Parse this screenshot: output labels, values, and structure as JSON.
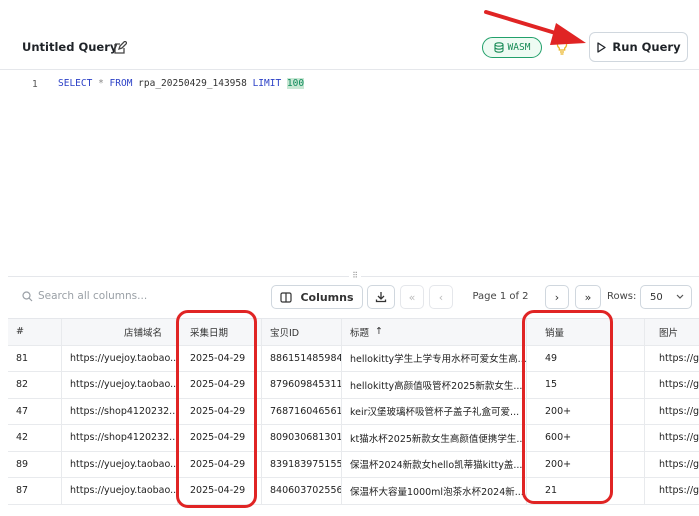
{
  "header": {
    "title": "Untitled Query",
    "engine_badge": "WASM",
    "run_label": "Run Query"
  },
  "editor": {
    "line_number": "1",
    "tokens": {
      "select": "SELECT",
      "star": "*",
      "from": "FROM",
      "table": "rpa_20250429_143958",
      "limit": "LIMIT",
      "limit_value": "100"
    }
  },
  "toolbar": {
    "search_placeholder": "Search all columns...",
    "columns_label": "Columns",
    "page_text": "Page 1 of 2",
    "rows_label": "Rows:",
    "rows_value": "50"
  },
  "table": {
    "columns": [
      "#",
      "店铺域名",
      "采集日期",
      "宝贝ID",
      "标题",
      "销量",
      "图片"
    ],
    "sort_indicator": "↑",
    "rows": [
      [
        "81",
        "https://yuejoy.taobao....",
        "2025-04-29",
        "886151485984",
        "hellokitty学生上学专用水杯可爱女生高...",
        "49",
        "https://g"
      ],
      [
        "82",
        "https://yuejoy.taobao....",
        "2025-04-29",
        "879609845311",
        "hellokitty高颜值吸管杯2025新款女生...",
        "15",
        "https://g"
      ],
      [
        "47",
        "https://shop4120232...",
        "2025-04-29",
        "768716046561",
        "keir汉堡玻璃杯吸管杯子盖子礼盒可爱...",
        "200+",
        "https://g"
      ],
      [
        "42",
        "https://shop4120232...",
        "2025-04-29",
        "809030681301",
        "kt猫水杯2025新款女生高颜值便携学生...",
        "600+",
        "https://g"
      ],
      [
        "89",
        "https://yuejoy.taobao....",
        "2025-04-29",
        "839183975155",
        "保温杯2024新款女hello凯蒂猫kitty盖...",
        "200+",
        "https://g"
      ],
      [
        "87",
        "https://yuejoy.taobao....",
        "2025-04-29",
        "840603702556",
        "保温杯大容量1000ml泡茶水杯2024新...",
        "21",
        "https://g"
      ]
    ]
  },
  "colors": {
    "annotation": "#e02424",
    "wasm_green": "#22a06b",
    "keyword_blue": "#2a3fc6"
  }
}
